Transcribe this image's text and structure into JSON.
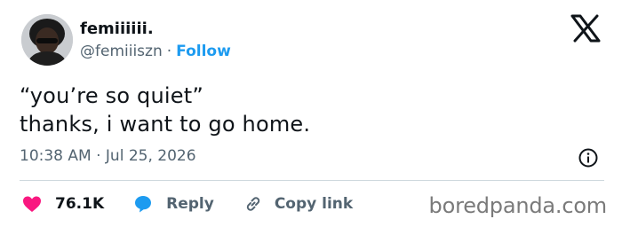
{
  "author": {
    "display_name": "femiiiiii.",
    "handle": "@femiiiszn",
    "separator": "·",
    "follow_label": "Follow",
    "avatar_icon": "profile-photo"
  },
  "brand_icon": "x-logo-icon",
  "tweet": {
    "lines": [
      "“you’re so quiet”",
      "thanks, i want to go home."
    ]
  },
  "meta": {
    "time": "10:38 AM",
    "separator": "·",
    "date": "Jul 25, 2026",
    "info_icon": "info-icon"
  },
  "actions": {
    "likes": "76.1K",
    "reply_label": "Reply",
    "copy_label": "Copy link"
  },
  "colors": {
    "accent": "#1d9bf0",
    "like": "#f91880",
    "text": "#0f1419",
    "muted": "#536471",
    "divider": "#cfd9de"
  },
  "watermark": "boredpanda.com"
}
